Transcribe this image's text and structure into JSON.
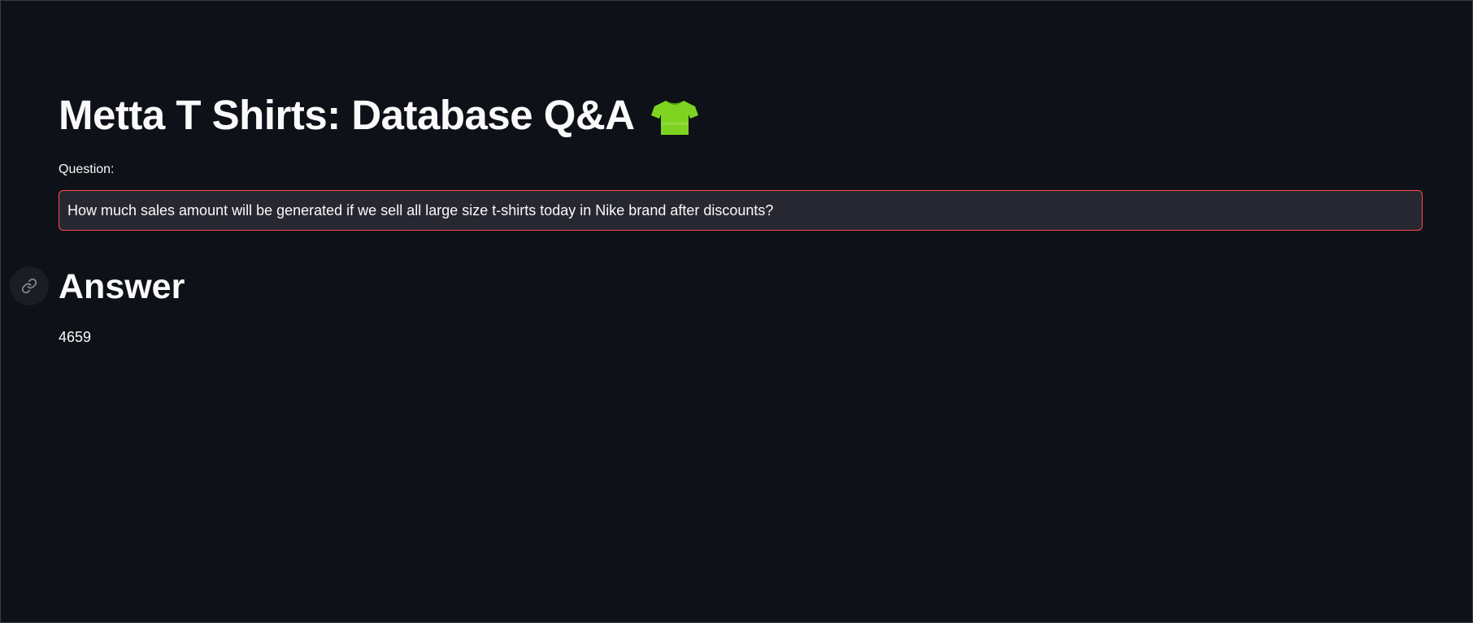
{
  "page": {
    "title": "Metta T Shirts: Database Q&A",
    "title_icon": "t-shirt-icon"
  },
  "question": {
    "label": "Question:",
    "value": "How much sales amount will be generated if we sell all large size t-shirts today in Nike brand after discounts?"
  },
  "answer": {
    "heading": "Answer",
    "anchor_icon": "link-icon",
    "value": "4659"
  },
  "colors": {
    "background": "#0e1117",
    "input_background": "#262730",
    "input_border_focus": "#ff4b4b",
    "text": "#fafafa",
    "tshirt_green": "#7ed321"
  }
}
